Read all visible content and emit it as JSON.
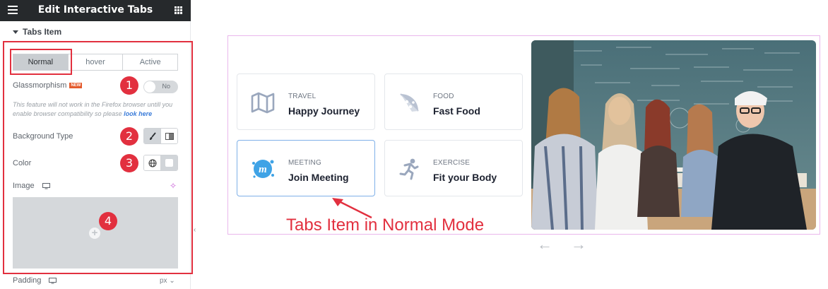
{
  "sidebar": {
    "title": "Edit Interactive Tabs",
    "section_title": "Tabs Item",
    "state_tabs": [
      "Normal",
      "hover",
      "Active"
    ],
    "active_state": "Normal",
    "glassmorphism": {
      "label": "Glassmorphism",
      "badge": "NEW",
      "toggle_text": "No"
    },
    "note": {
      "text": "This feature will not work in the Firefox browser untill you enable browser compatibility so please ",
      "link": "look here"
    },
    "background_type_label": "Background Type",
    "color_label": "Color",
    "image_label": "Image",
    "padding_label": "Padding",
    "padding_unit": "px",
    "markers": [
      "1",
      "2",
      "3",
      "4"
    ]
  },
  "preview": {
    "cards": [
      {
        "kicker": "TRAVEL",
        "title": "Happy Journey",
        "icon": "map-icon"
      },
      {
        "kicker": "FOOD",
        "title": "Fast Food",
        "icon": "pizza-icon"
      },
      {
        "kicker": "MEETING",
        "title": "Join Meeting",
        "icon": "meeting-icon"
      },
      {
        "kicker": "EXERCISE",
        "title": "Fit your Body",
        "icon": "running-icon"
      }
    ],
    "annotation": "Tabs Item in Normal Mode",
    "prev_arrow": "←",
    "next_arrow": "→"
  },
  "colors": {
    "accent_red": "#e2303f",
    "topbar": "#26292c",
    "active_border": "#7fb0e8",
    "preview_border": "#e9b7ec"
  }
}
